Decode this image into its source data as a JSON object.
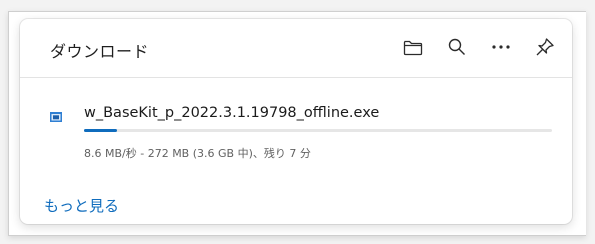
{
  "panel": {
    "title": "ダウンロード",
    "toolbar": [
      {
        "icon": "folder-icon",
        "label": "Open downloads folder"
      },
      {
        "icon": "search-icon",
        "label": "Search downloads"
      },
      {
        "icon": "more-icon",
        "label": "More options"
      },
      {
        "icon": "pin-icon",
        "label": "Pin"
      }
    ]
  },
  "download": {
    "filename": "w_BaseKit_p_2022.3.1.19798_offline.exe",
    "status": "8.6 MB/秒 - 272 MB (3.6 GB 中)、残り 7 分",
    "progress": 0.07,
    "icon": "installer-icon"
  },
  "footer": {
    "more_label": "もっと見る"
  },
  "colors": {
    "accent": "#0f6cbd",
    "text": "#1b1b1b",
    "muted": "#616161"
  }
}
